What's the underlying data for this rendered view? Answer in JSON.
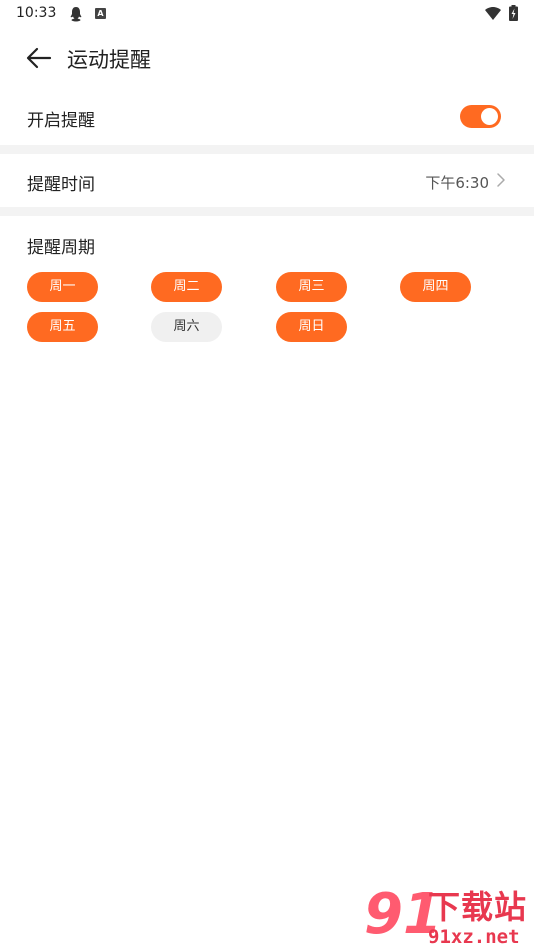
{
  "status_bar": {
    "time": "10:33",
    "icons": [
      "qq-icon",
      "a-badge-icon",
      "wifi-icon",
      "battery-charging-icon"
    ],
    "badge_letter": "A"
  },
  "header": {
    "title": "运动提醒",
    "back_icon": "arrow-left-icon"
  },
  "reminder_toggle": {
    "label": "开启提醒",
    "enabled": true
  },
  "reminder_time": {
    "label": "提醒时间",
    "value": "下午6:30",
    "chevron_icon": "chevron-right-icon"
  },
  "reminder_cycle": {
    "label": "提醒周期",
    "days": [
      {
        "label": "周一",
        "selected": true
      },
      {
        "label": "周二",
        "selected": true
      },
      {
        "label": "周三",
        "selected": true
      },
      {
        "label": "周四",
        "selected": true
      },
      {
        "label": "周五",
        "selected": true
      },
      {
        "label": "周六",
        "selected": false
      },
      {
        "label": "周日",
        "selected": true
      }
    ]
  },
  "colors": {
    "accent": "#ff6a21",
    "chip_off": "#f0f0f0",
    "divider": "#f3f3f3"
  },
  "watermark": {
    "logo_digits": "91",
    "text": "下载站",
    "url": "91xz.net"
  }
}
